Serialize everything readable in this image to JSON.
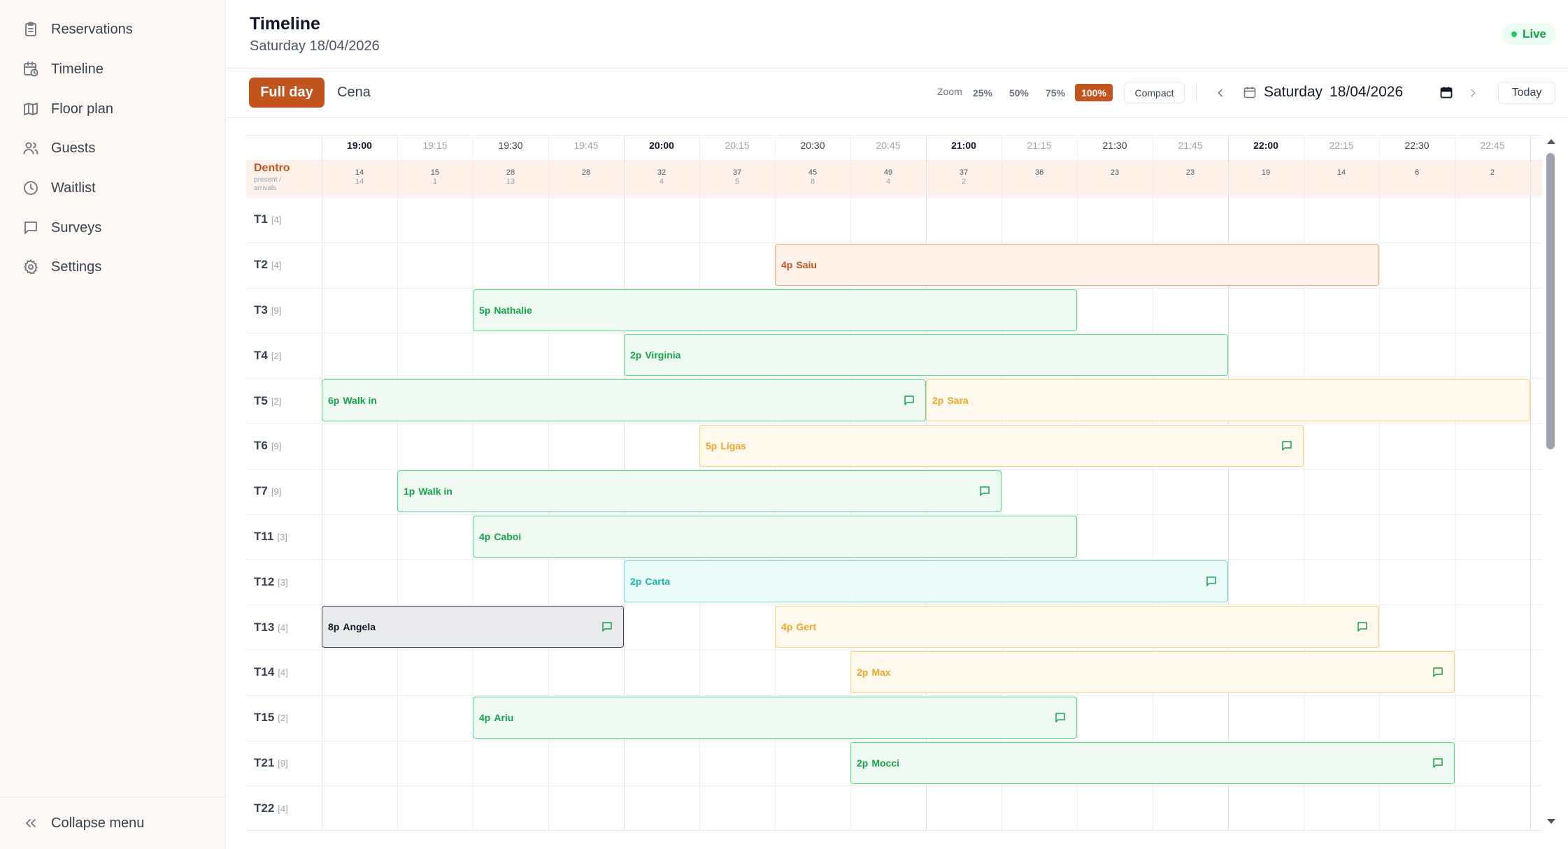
{
  "sidebar": {
    "items": [
      {
        "label": "Reservations",
        "icon": "clipboard-icon"
      },
      {
        "label": "Timeline",
        "icon": "calendar-clock-icon"
      },
      {
        "label": "Floor plan",
        "icon": "map-icon"
      },
      {
        "label": "Guests",
        "icon": "users-icon"
      },
      {
        "label": "Waitlist",
        "icon": "clock-icon"
      },
      {
        "label": "Surveys",
        "icon": "message-square-icon"
      },
      {
        "label": "Settings",
        "icon": "gear-icon"
      }
    ],
    "collapse_label": "Collapse menu"
  },
  "header": {
    "title": "Timeline",
    "date": "Saturday 18/04/2026",
    "live": "Live"
  },
  "toolbar": {
    "tabs": [
      "Full day",
      "Cena"
    ],
    "zoom_label": "Zoom",
    "zoom_options": [
      "25%",
      "50%",
      "75%",
      "100%"
    ],
    "zoom_selected": "100%",
    "compact_label": "Compact",
    "date_day": "Saturday",
    "date_value": "18/04/2026",
    "today_label": "Today"
  },
  "timeline": {
    "times": [
      "19:00",
      "19:15",
      "19:30",
      "19:45",
      "20:00",
      "20:15",
      "20:30",
      "20:45",
      "21:00",
      "21:15",
      "21:30",
      "21:45",
      "22:00",
      "22:15",
      "22:30",
      "22:45"
    ],
    "area_name": "Dentro",
    "area_sub": "present / arrivals",
    "present": [
      "14",
      "15",
      "28",
      "28",
      "32",
      "37",
      "45",
      "49",
      "37",
      "36",
      "23",
      "23",
      "19",
      "14",
      "6",
      "2"
    ],
    "arrivals": [
      "14",
      "1",
      "13",
      "",
      "4",
      "5",
      "8",
      "4",
      "2",
      "",
      "",
      "",
      "",
      "",
      "",
      ""
    ],
    "tables": [
      {
        "name": "T1",
        "cap": "[4]"
      },
      {
        "name": "T2",
        "cap": "[4]"
      },
      {
        "name": "T3",
        "cap": "[9]"
      },
      {
        "name": "T4",
        "cap": "[2]"
      },
      {
        "name": "T5",
        "cap": "[2]"
      },
      {
        "name": "T6",
        "cap": "[9]"
      },
      {
        "name": "T7",
        "cap": "[9]"
      },
      {
        "name": "T11",
        "cap": "[3]"
      },
      {
        "name": "T12",
        "cap": "[3]"
      },
      {
        "name": "T13",
        "cap": "[4]"
      },
      {
        "name": "T14",
        "cap": "[4]"
      },
      {
        "name": "T15",
        "cap": "[2]"
      },
      {
        "name": "T21",
        "cap": "[9]"
      },
      {
        "name": "T22",
        "cap": "[4]"
      }
    ],
    "reservations": [
      {
        "row": 1,
        "start": "20:30",
        "end": "22:30",
        "party": "4p",
        "name": "Saiu",
        "status": "orange",
        "note": false
      },
      {
        "row": 2,
        "start": "19:30",
        "end": "21:30",
        "party": "5p",
        "name": "Nathalie",
        "status": "green",
        "note": false
      },
      {
        "row": 3,
        "start": "20:00",
        "end": "22:00",
        "party": "2p",
        "name": "Virginia",
        "status": "green",
        "note": false
      },
      {
        "row": 4,
        "start": "19:00",
        "end": "21:00",
        "party": "6p",
        "name": "Walk in",
        "status": "green",
        "note": true
      },
      {
        "row": 4,
        "start": "21:00",
        "end": "23:00",
        "party": "2p",
        "name": "Sara",
        "status": "yellow",
        "note": false
      },
      {
        "row": 5,
        "start": "20:15",
        "end": "22:15",
        "party": "5p",
        "name": "Ligas",
        "status": "yellow",
        "note": true
      },
      {
        "row": 6,
        "start": "19:15",
        "end": "21:15",
        "party": "1p",
        "name": "Walk in",
        "status": "green",
        "note": true
      },
      {
        "row": 7,
        "start": "19:30",
        "end": "21:30",
        "party": "4p",
        "name": "Caboi",
        "status": "green",
        "note": false
      },
      {
        "row": 8,
        "start": "20:00",
        "end": "22:00",
        "party": "2p",
        "name": "Carta",
        "status": "teal",
        "note": true
      },
      {
        "row": 9,
        "start": "19:00",
        "end": "20:00",
        "party": "8p",
        "name": "Angela",
        "status": "gray",
        "note": true
      },
      {
        "row": 9,
        "start": "20:30",
        "end": "22:30",
        "party": "4p",
        "name": "Gert",
        "status": "yellow",
        "note": true
      },
      {
        "row": 10,
        "start": "20:45",
        "end": "22:45",
        "party": "2p",
        "name": "Max",
        "status": "yellow",
        "note": true
      },
      {
        "row": 11,
        "start": "19:30",
        "end": "21:30",
        "party": "4p",
        "name": "Ariu",
        "status": "green",
        "note": true
      },
      {
        "row": 12,
        "start": "20:45",
        "end": "22:45",
        "party": "2p",
        "name": "Mocci",
        "status": "green",
        "note": true
      }
    ]
  }
}
